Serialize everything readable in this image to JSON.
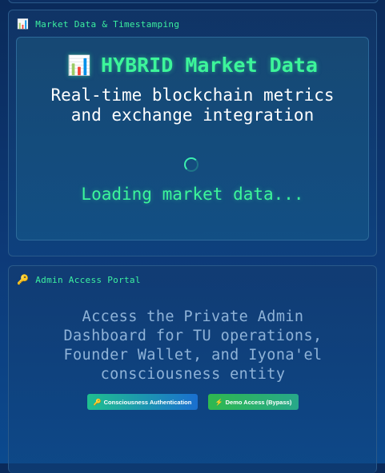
{
  "market_section": {
    "icon": "bar-chart-icon",
    "title": "Market Data & Timestamping",
    "card": {
      "title_icon": "bar-chart-icon",
      "title": "HYBRID Market Data",
      "subtitle_line1": "Real-time blockchain metrics",
      "subtitle_line2": "and exchange integration",
      "loading_text": "Loading market data..."
    }
  },
  "admin_section": {
    "icon": "key-icon",
    "title": "Admin Access Portal",
    "description_lines": [
      "Access the Private Admin",
      "Dashboard for TU operations,",
      "Founder Wallet, and Iyona'el",
      "consciousness entity"
    ],
    "buttons": {
      "auth_label": "Consciousness Authentication",
      "demo_label": "Demo Access (Bypass)"
    }
  },
  "colors": {
    "accent_green": "#3cf59a",
    "background": "#0d3a78"
  }
}
